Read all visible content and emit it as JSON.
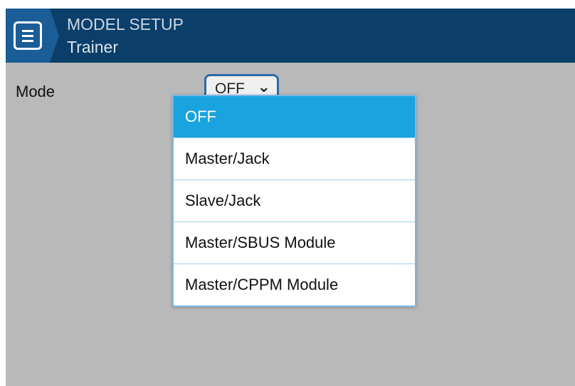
{
  "header": {
    "title": "MODEL SETUP",
    "subtitle": "Trainer",
    "icon": "menu-icon"
  },
  "form": {
    "mode_label": "Mode",
    "mode_value": "OFF",
    "chevron": "❯"
  },
  "dropdown": {
    "items": [
      {
        "label": "OFF",
        "selected": true
      },
      {
        "label": "Master/Jack",
        "selected": false
      },
      {
        "label": "Slave/Jack",
        "selected": false
      },
      {
        "label": "Master/SBUS Module",
        "selected": false
      },
      {
        "label": "Master/CPPM Module",
        "selected": false
      }
    ]
  },
  "colors": {
    "header_bg": "#0b3e69",
    "menu_tab_bg": "#1a5d97",
    "selection_bg": "#19a3df",
    "screen_bg": "#b9b9b9"
  }
}
